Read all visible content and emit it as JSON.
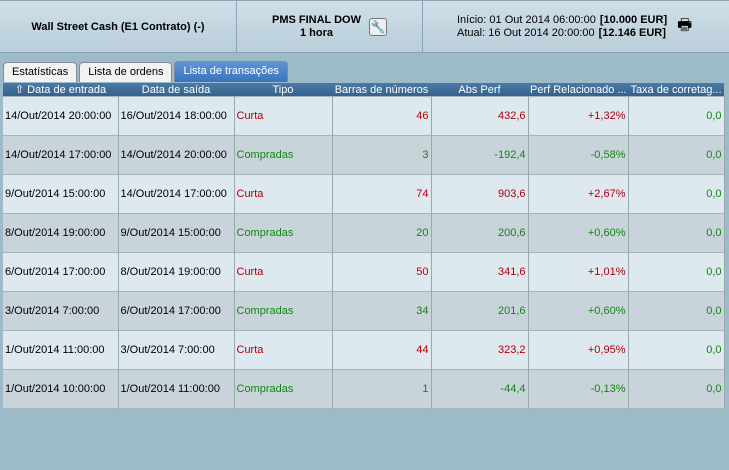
{
  "header": {
    "account": "Wall Street Cash (E1 Contrato) (-)",
    "strategy": "PMS FINAL DOW",
    "timeframe": "1 hora",
    "start_label": "Início:",
    "start_date": "01 Out 2014 06:00:00",
    "start_value": "[10.000 EUR]",
    "current_label": "Atual:",
    "current_date": "16 Out 2014 20:00:00",
    "current_value": "[12.146 EUR]"
  },
  "tabs": [
    "Estatísticas",
    "Lista de ordens",
    "Lista de transações"
  ],
  "columns": [
    "⇧ Data de entrada",
    "Data de saída",
    "Tipo",
    "Barras de números",
    "Abs Perf",
    "Perf Relacionado ...",
    "Taxa de corretag..."
  ],
  "rows": [
    [
      "14/Out/2014 20:00:00",
      "16/Out/2014 18:00:00",
      "Curta",
      "46",
      "432,6",
      "+1,32%",
      "0,0"
    ],
    [
      "14/Out/2014 17:00:00",
      "14/Out/2014 20:00:00",
      "Compradas",
      "3",
      "-192,4",
      "-0,58%",
      "0,0"
    ],
    [
      "9/Out/2014 15:00:00",
      "14/Out/2014 17:00:00",
      "Curta",
      "74",
      "903,6",
      "+2,67%",
      "0,0"
    ],
    [
      "8/Out/2014 19:00:00",
      "9/Out/2014 15:00:00",
      "Compradas",
      "20",
      "200,6",
      "+0,60%",
      "0,0"
    ],
    [
      "6/Out/2014 17:00:00",
      "8/Out/2014 19:00:00",
      "Curta",
      "50",
      "341,6",
      "+1,01%",
      "0,0"
    ],
    [
      "3/Out/2014 7:00:00",
      "6/Out/2014 17:00:00",
      "Compradas",
      "34",
      "201,6",
      "+0,60%",
      "0,0"
    ],
    [
      "1/Out/2014 11:00:00",
      "3/Out/2014 7:00:00",
      "Curta",
      "44",
      "323,2",
      "+0,95%",
      "0,0"
    ],
    [
      "1/Out/2014 10:00:00",
      "1/Out/2014 11:00:00",
      "Compradas",
      "1",
      "-44,4",
      "-0,13%",
      "0,0"
    ]
  ],
  "colors": {
    "short": "#b0000c",
    "long": "#118811",
    "header": "#3a6a97"
  }
}
